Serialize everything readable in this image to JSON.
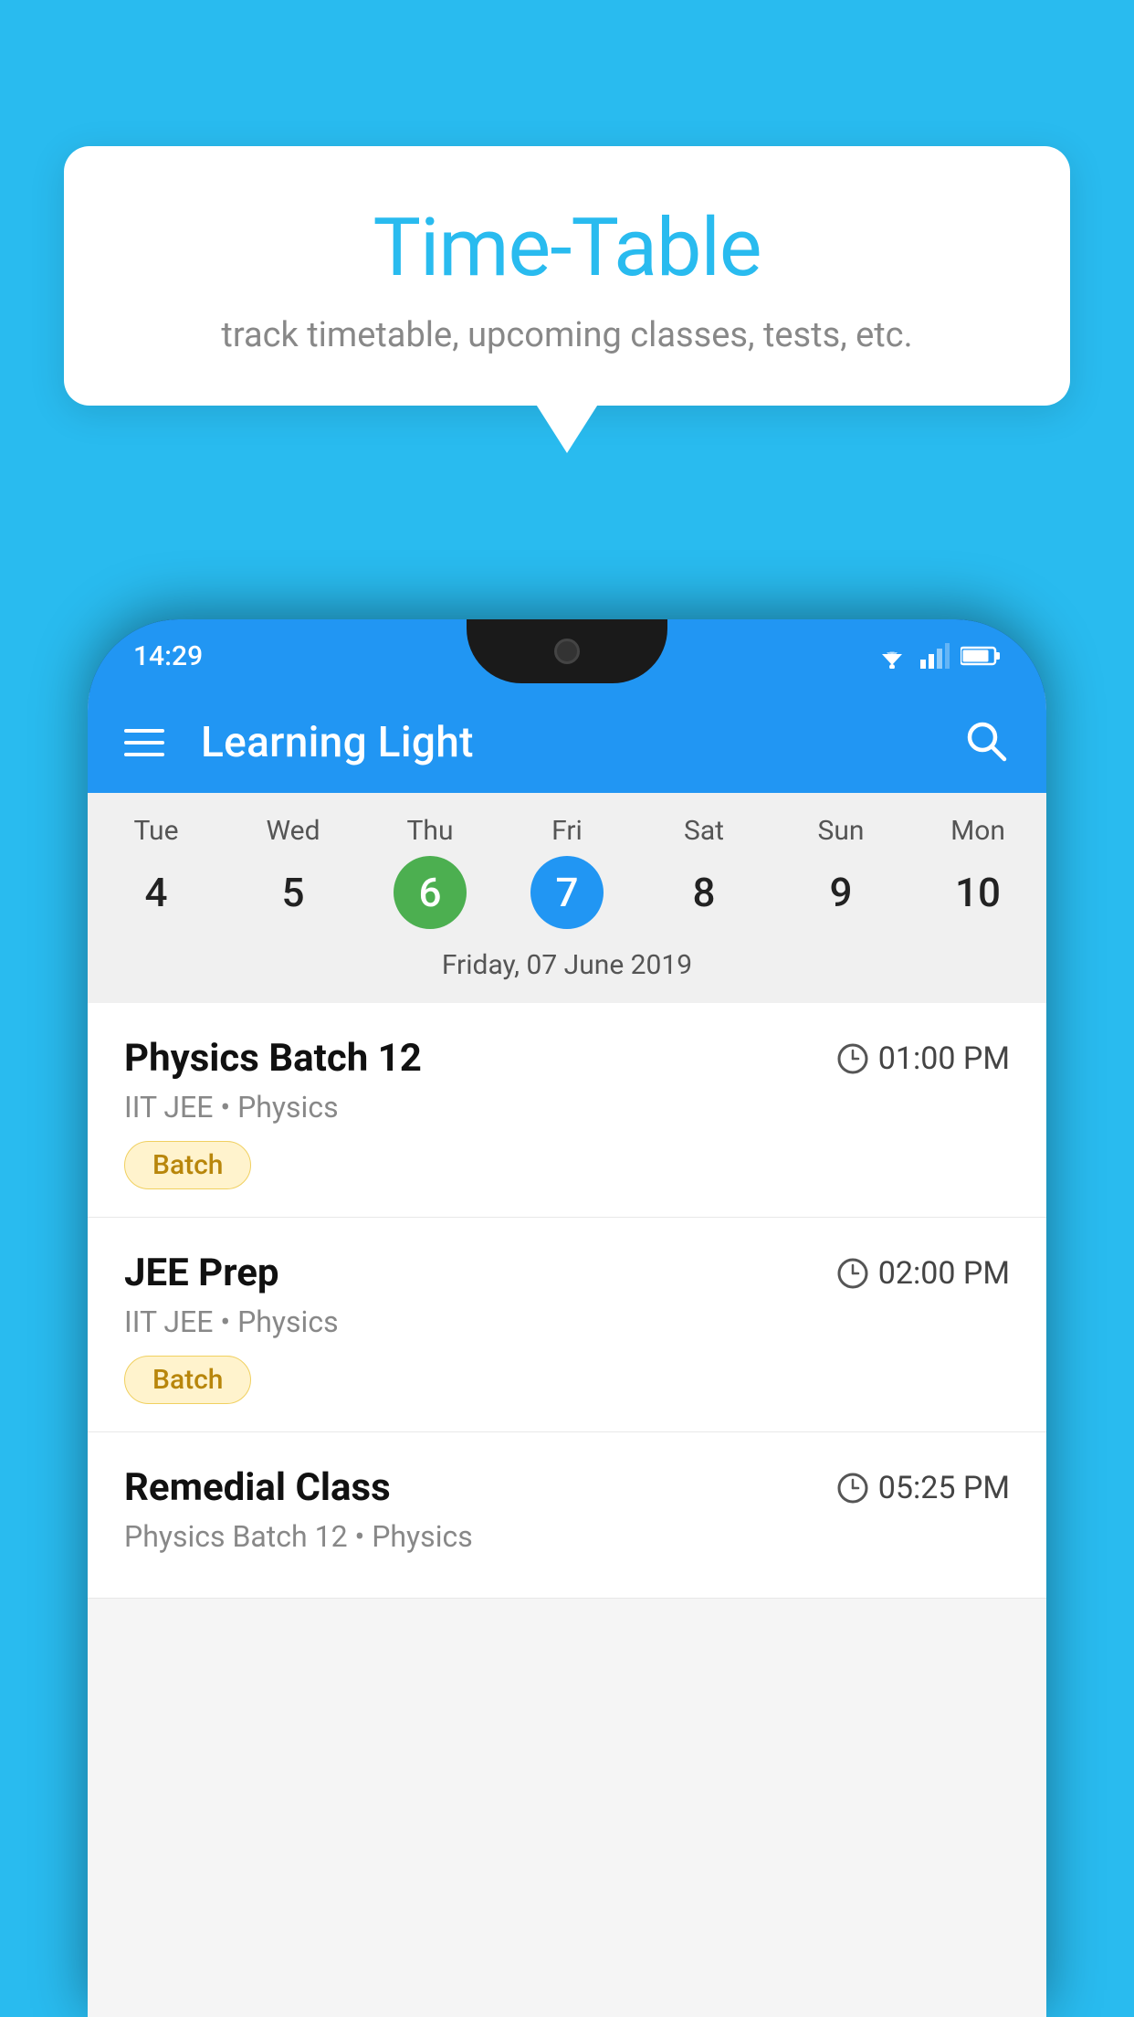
{
  "background_color": "#29BBEF",
  "tooltip": {
    "title": "Time-Table",
    "subtitle": "track timetable, upcoming classes, tests, etc."
  },
  "phone": {
    "status_bar": {
      "time": "14:29"
    },
    "app_bar": {
      "title": "Learning Light",
      "menu_icon": "hamburger-icon",
      "search_icon": "search-icon"
    },
    "calendar": {
      "days": [
        {
          "name": "Tue",
          "number": "4",
          "state": "normal"
        },
        {
          "name": "Wed",
          "number": "5",
          "state": "normal"
        },
        {
          "name": "Thu",
          "number": "6",
          "state": "today"
        },
        {
          "name": "Fri",
          "number": "7",
          "state": "selected"
        },
        {
          "name": "Sat",
          "number": "8",
          "state": "normal"
        },
        {
          "name": "Sun",
          "number": "9",
          "state": "normal"
        },
        {
          "name": "Mon",
          "number": "10",
          "state": "normal"
        }
      ],
      "selected_date_label": "Friday, 07 June 2019"
    },
    "schedule": [
      {
        "title": "Physics Batch 12",
        "time": "01:00 PM",
        "subtitle": "IIT JEE • Physics",
        "badge": "Batch"
      },
      {
        "title": "JEE Prep",
        "time": "02:00 PM",
        "subtitle": "IIT JEE • Physics",
        "badge": "Batch"
      },
      {
        "title": "Remedial Class",
        "time": "05:25 PM",
        "subtitle": "Physics Batch 12 • Physics",
        "badge": null
      }
    ]
  }
}
